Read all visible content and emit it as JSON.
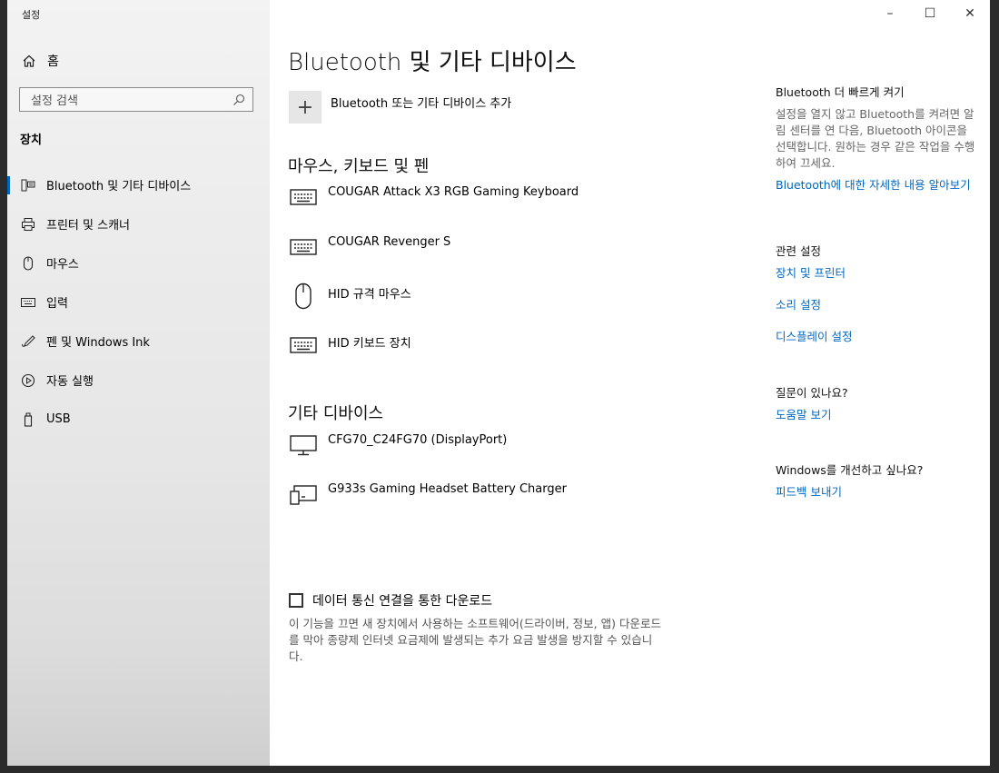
{
  "app_title": "설정",
  "window_controls": {
    "minimize": "–",
    "maximize": "☐",
    "close": "✕"
  },
  "sidebar": {
    "home": "홈",
    "search_placeholder": "설정 검색",
    "section": "장치",
    "items": [
      {
        "label": "Bluetooth 및 기타 디바이스",
        "icon": "bluetooth-devices-icon",
        "active": true
      },
      {
        "label": "프린터 및 스캐너",
        "icon": "printer-icon"
      },
      {
        "label": "마우스",
        "icon": "mouse-icon"
      },
      {
        "label": "입력",
        "icon": "keyboard-icon"
      },
      {
        "label": "펜 및 Windows Ink",
        "icon": "pen-icon"
      },
      {
        "label": "자동 실행",
        "icon": "autoplay-icon"
      },
      {
        "label": "USB",
        "icon": "usb-icon"
      }
    ]
  },
  "main": {
    "title": "Bluetooth 및 기타 디바이스",
    "add_device": "Bluetooth 또는 기타 디바이스 추가",
    "input_section": "마우스, 키보드 및 펜",
    "input_devices": [
      {
        "name": "COUGAR Attack X3 RGB Gaming Keyboard",
        "icon": "keyboard-icon"
      },
      {
        "name": "COUGAR Revenger S",
        "icon": "keyboard-icon"
      },
      {
        "name": "HID 규격 마우스",
        "icon": "mouse-icon"
      },
      {
        "name": "HID 키보드 장치",
        "icon": "keyboard-icon"
      }
    ],
    "other_section": "기타 디바이스",
    "other_devices": [
      {
        "name": "CFG70_C24FG70 (DisplayPort)",
        "icon": "monitor-icon"
      },
      {
        "name": "G933s Gaming Headset Battery Charger",
        "icon": "device-icon"
      }
    ],
    "metered_label": "데이터 통신 연결을 통한 다운로드",
    "metered_checked": false,
    "metered_desc": "이 기능을 끄면 새 장치에서 사용하는 소프트웨어(드라이버, 정보, 앱) 다운로드를 막아 종량제 인터넷 요금제에 발생되는 추가 요금 발생을 방지할 수 있습니다."
  },
  "right_panel": {
    "quick_title": "Bluetooth 더 빠르게 켜기",
    "quick_text": "설정을 열지 않고 Bluetooth를 켜려면 알림 센터를 연 다음, Bluetooth 아이콘을 선택합니다. 원하는 경우 같은 작업을 수행하여 끄세요.",
    "quick_link": "Bluetooth에 대한 자세한 내용 알아보기",
    "related_title": "관련 설정",
    "related_links": [
      "장치 및 프린터",
      "소리 설정",
      "디스플레이 설정"
    ],
    "question_title": "질문이 있나요?",
    "question_link": "도움말 보기",
    "improve_title": "Windows를 개선하고 싶나요?",
    "improve_link": "피드백 보내기"
  },
  "colors": {
    "accent": "#0067c0",
    "sidebar_bg": "#eeeeee",
    "main_bg": "#ffffff"
  }
}
